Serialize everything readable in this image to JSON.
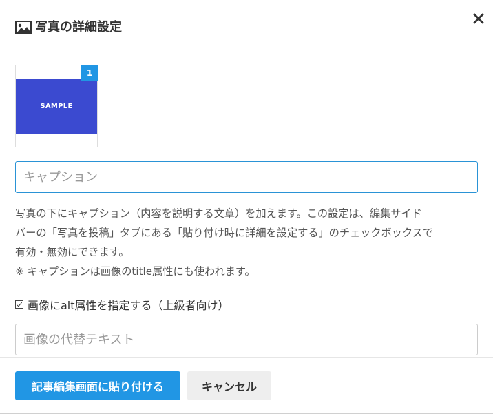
{
  "dialog": {
    "title": "写真の詳細設定",
    "title_icon": "image-icon",
    "close_icon": "close-icon"
  },
  "thumbnail": {
    "image_text": "SAMPLE",
    "badge": "1",
    "image_color": "#3b4ad0",
    "badge_color": "#2196e4"
  },
  "caption": {
    "placeholder": "キャプション",
    "value": ""
  },
  "help_text": {
    "line1": "写真の下にキャプション（内容を説明する文章）を加えます。この設定は、編集サイド",
    "line2": "バーの「写真を投稿」タブにある「貼り付け時に詳細を設定する」のチェックボックスで",
    "line3": "有効・無効にできます。",
    "line4": "※ キャプションは画像のtitle属性にも使われます。"
  },
  "alt": {
    "checkbox_label": "画像にalt属性を指定する（上級者向け）",
    "checked": true,
    "placeholder": "画像の代替テキスト",
    "value": ""
  },
  "footer": {
    "insert_label": "記事編集画面に貼り付ける",
    "cancel_label": "キャンセル",
    "accent_color": "#2196e4"
  }
}
